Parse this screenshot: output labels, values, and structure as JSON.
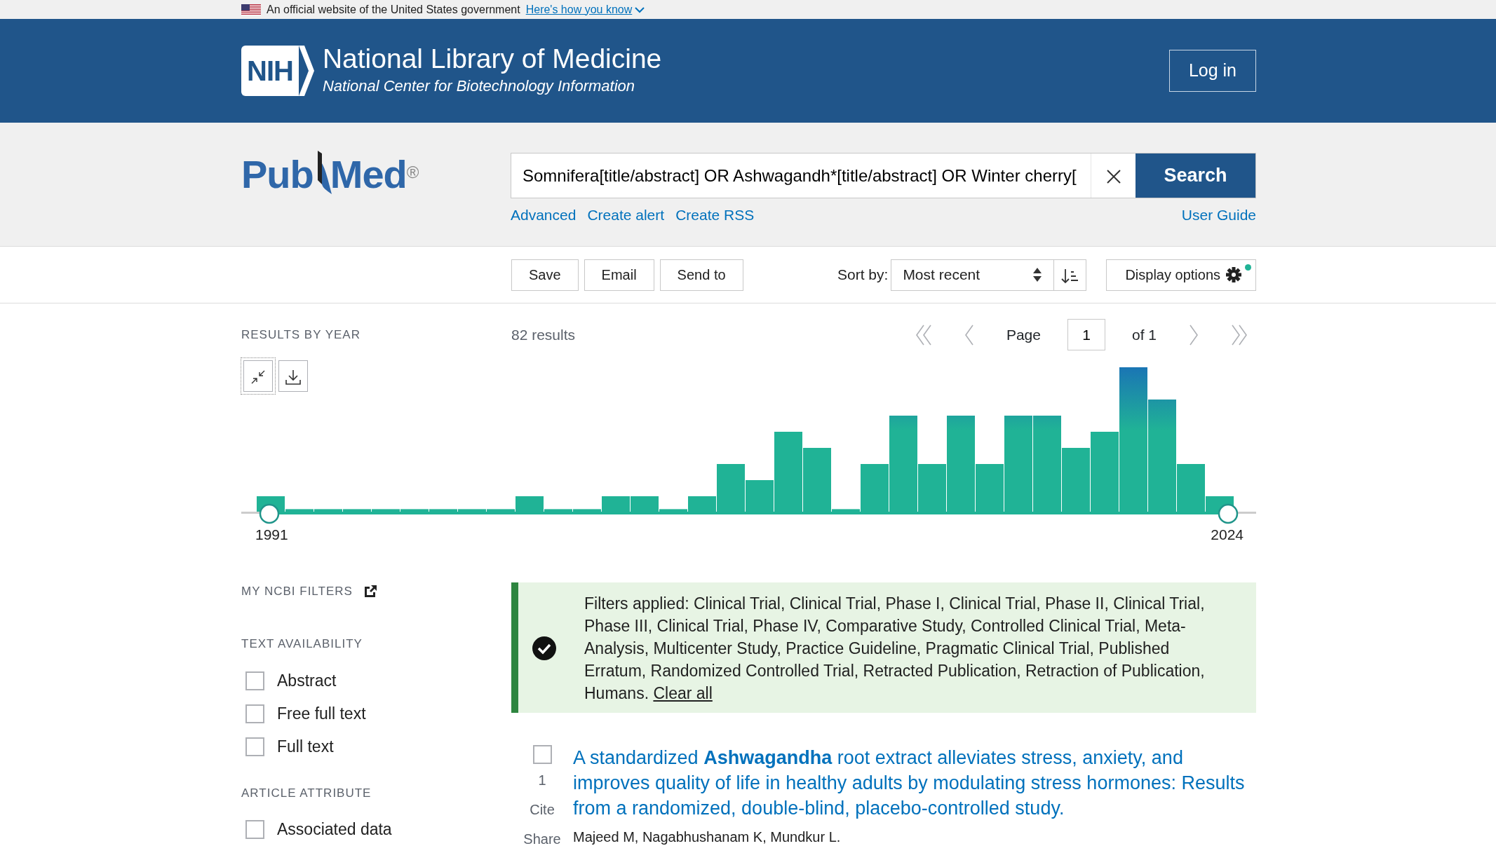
{
  "gov_banner": {
    "text": "An official website of the United States government",
    "link": "Here's how you know"
  },
  "header": {
    "logo_text": "NIH",
    "title": "National Library of Medicine",
    "subtitle": "National Center for Biotechnology Information",
    "login": "Log in"
  },
  "search": {
    "logo": {
      "part1": "Pub",
      "part2": "Med",
      "mark": "®"
    },
    "value": "Somnifera[title/abstract] OR Ashwagandh*[title/abstract] OR Winter cherry[",
    "button": "Search",
    "links": [
      "Advanced",
      "Create alert",
      "Create RSS"
    ],
    "user_guide": "User Guide"
  },
  "toolbar": {
    "buttons": [
      "Save",
      "Email",
      "Send to"
    ],
    "sort_label": "Sort by:",
    "sort_value": "Most recent",
    "display_options": "Display options",
    "display_options_indicator": true
  },
  "results_by_year": {
    "title": "RESULTS BY YEAR",
    "start_year": "1991",
    "end_year": "2024",
    "handles": [
      {
        "level": 0
      },
      {
        "level": 1
      }
    ]
  },
  "results_count": "82 results",
  "pagination": {
    "page_label": "Page",
    "page": "1",
    "of": "of 1"
  },
  "my_ncbi_filters": "MY NCBI FILTERS",
  "filter_groups": [
    {
      "title": "TEXT AVAILABILITY",
      "items": [
        {
          "label": "Abstract",
          "checked": false
        },
        {
          "label": "Free full text",
          "checked": false
        },
        {
          "label": "Full text",
          "checked": false
        }
      ]
    },
    {
      "title": "ARTICLE ATTRIBUTE",
      "items": [
        {
          "label": "Associated data",
          "checked": false
        }
      ]
    }
  ],
  "filters_applied": {
    "text": "Filters applied: Clinical Trial, Clinical Trial, Phase I, Clinical Trial, Phase II, Clinical Trial, Phase III, Clinical Trial, Phase IV, Comparative Study, Controlled Clinical Trial, Meta-Analysis, Multicenter Study, Practice Guideline, Pragmatic Clinical Trial, Published Erratum, Randomized Controlled Trial, Retracted Publication, Retraction of Publication, Humans.",
    "clear": "Clear all"
  },
  "results": [
    {
      "checked": false,
      "number": "1",
      "actions": [
        "Cite",
        "Share"
      ],
      "title": "A standardized **Ashwagandha** root extract alleviates stress, anxiety, and improves quality of life in healthy adults by modulating stress hormones: Results from a randomized, double-blind, placebo-controlled study.",
      "authors": "Majeed M, Nagabhushanam K, Mundkur L."
    }
  ]
}
